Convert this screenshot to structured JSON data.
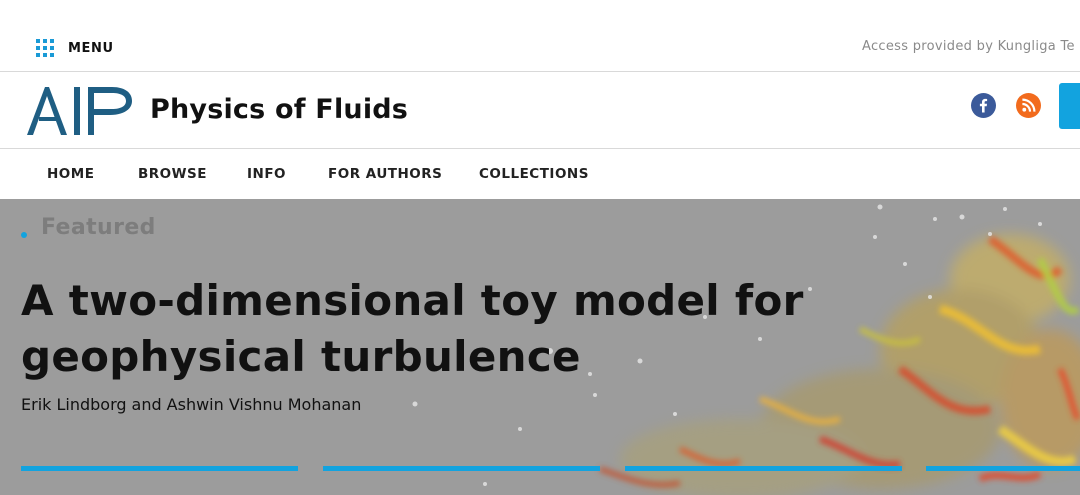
{
  "topbar": {
    "menu_label": "MENU",
    "access_text": "Access provided by Kungliga Te"
  },
  "header": {
    "logo_text": "AIP",
    "journal_title": "Physics of Fluids",
    "social": [
      {
        "name": "facebook-icon",
        "glyph": "f",
        "color": "#3b5a9a"
      },
      {
        "name": "rss-icon",
        "color": "#f26b1d"
      }
    ]
  },
  "nav": {
    "items": [
      {
        "label": "HOME"
      },
      {
        "label": "BROWSE"
      },
      {
        "label": "INFO"
      },
      {
        "label": "FOR AUTHORS"
      },
      {
        "label": "COLLECTIONS"
      }
    ]
  },
  "hero": {
    "kicker": "Featured",
    "title": "A two-dimensional toy model for geophysical turbulence",
    "authors": [
      "Erik Lindborg",
      "Ashwin Vishnu Mohanan"
    ],
    "author_joiner": "and",
    "carousel_slides": 4,
    "active_slide": 1
  },
  "colors": {
    "accent": "#12a3df",
    "hero_overlay": "#9c9c9c",
    "facebook": "#3b5a9a",
    "rss": "#f26b1d"
  }
}
